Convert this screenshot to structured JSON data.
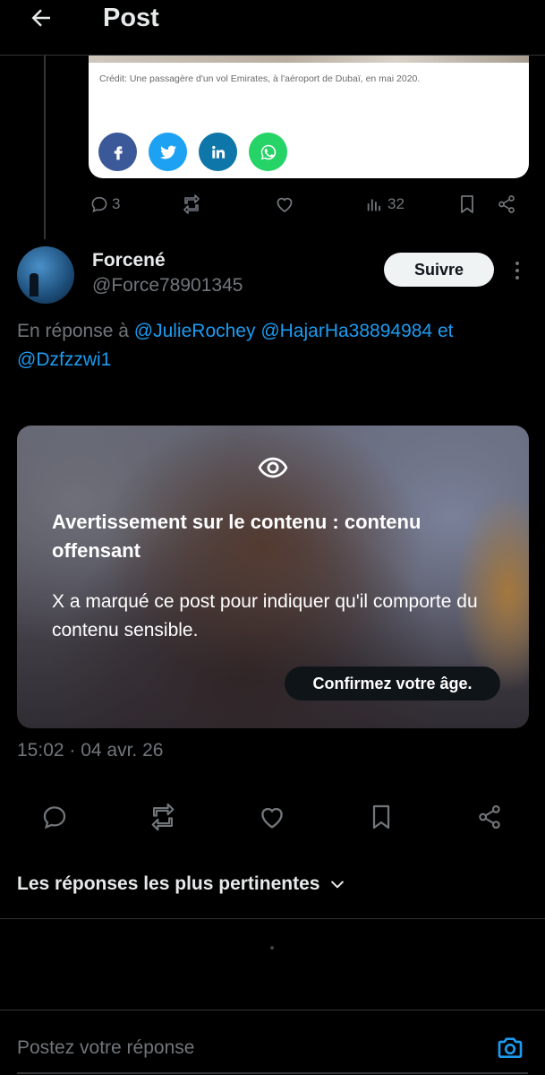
{
  "header": {
    "title": "Post"
  },
  "quoted_card": {
    "caption": "Crédit: Une passagère d'un vol Emirates, à l'aéroport de Dubaï, en mai 2020.",
    "share_buttons": [
      {
        "icon": "facebook-icon",
        "glyph": "f",
        "color": "#3b5998"
      },
      {
        "icon": "twitter-icon",
        "glyph": "bird",
        "color": "#1da1f2"
      },
      {
        "icon": "linkedin-icon",
        "glyph": "in",
        "color": "#0e76a8"
      },
      {
        "icon": "whatsapp-icon",
        "glyph": "phone",
        "color": "#25d366"
      }
    ]
  },
  "prev_post_actions": {
    "replies": "3",
    "views": "32"
  },
  "post": {
    "display_name": "Forcené",
    "handle": "@Force78901345",
    "follow_label": "Suivre",
    "reply_prefix": "En réponse à ",
    "mentions": [
      "@JulieRochey",
      "@HajarHa38894984",
      "@Dzfzzwi1"
    ],
    "mention_joiner": " et",
    "sensitive_warning": {
      "title": "Avertissement sur le contenu : contenu offensant",
      "text": "X a marqué ce post pour indiquer qu'il comporte du contenu sensible.",
      "button_label": "Confirmez votre âge."
    },
    "timestamp": "15:02 · 04 avr. 26"
  },
  "sort": {
    "label": "Les réponses les plus pertinentes"
  },
  "composer": {
    "placeholder": "Postez votre réponse"
  },
  "colors": {
    "accent": "#1d9bf0",
    "secondary_text": "#71767b",
    "primary_text": "#e7e9ea",
    "divider": "#2f3336"
  }
}
